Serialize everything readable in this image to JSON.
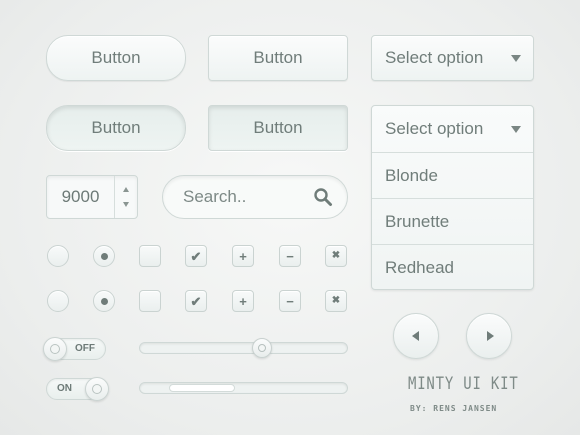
{
  "buttons": {
    "row1_pill": "Button",
    "row1_rect": "Button",
    "row2_pill": "Button",
    "row2_rect": "Button"
  },
  "select_closed": {
    "selected": "Select option"
  },
  "select_open": {
    "selected": "Select option",
    "options": [
      "Blonde",
      "Brunette",
      "Redhead"
    ]
  },
  "stepper": {
    "value": "9000"
  },
  "search": {
    "placeholder": "Search.."
  },
  "mini_controls": {
    "plus": "+",
    "minus": "−",
    "close": "✖",
    "check": "✔"
  },
  "toggles": {
    "off_label": "OFF",
    "on_label": "ON"
  },
  "sliders": {
    "single_value_percent": 59,
    "range_start_percent": 14,
    "range_end_percent": 46
  },
  "brand": {
    "title": "MINTY UI KIT",
    "byline": "BY: RENS JANSEN"
  }
}
